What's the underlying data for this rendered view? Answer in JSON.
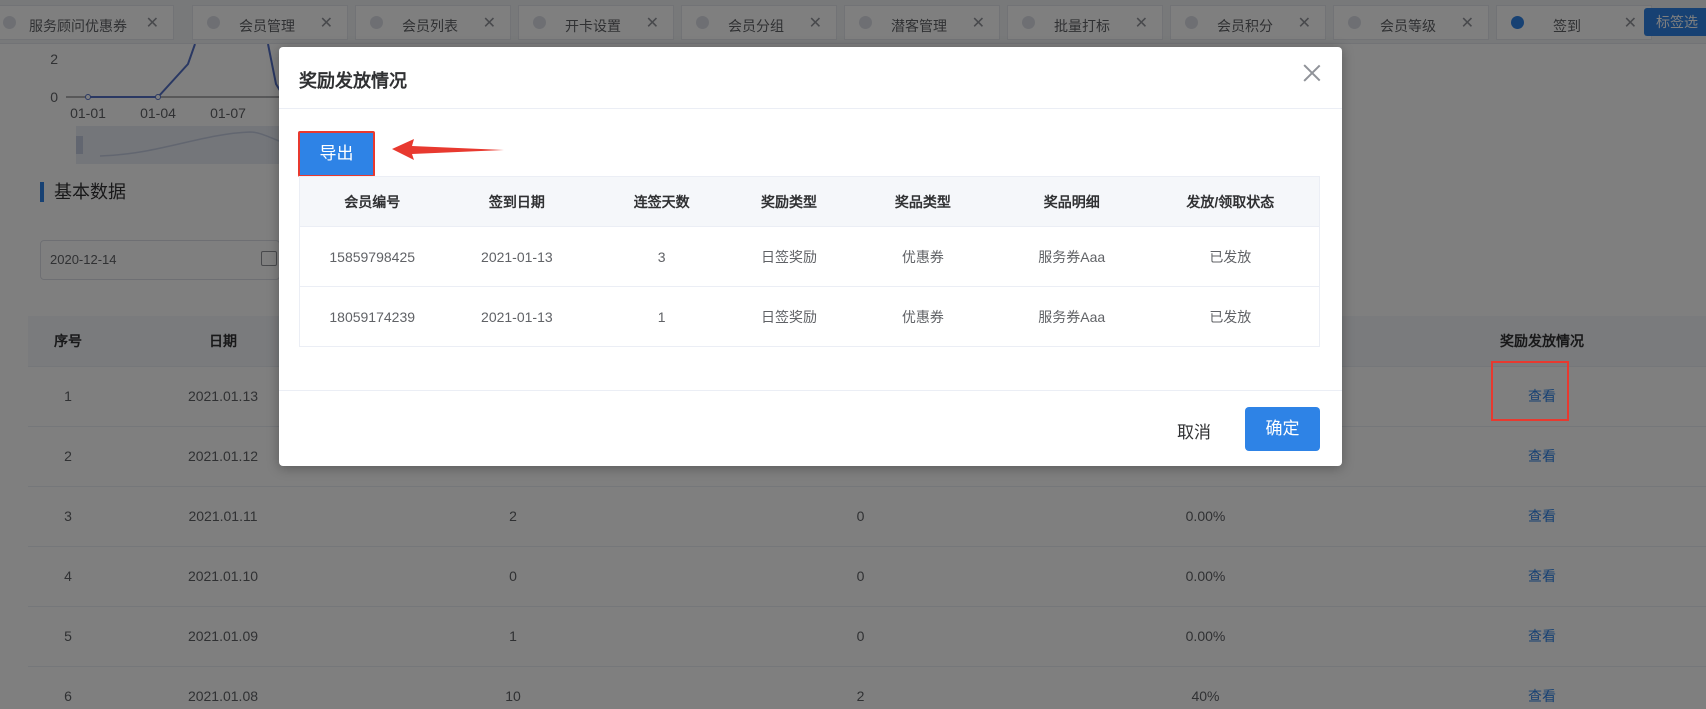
{
  "tabs": [
    {
      "label": "服务顾问优惠券",
      "active": false
    },
    {
      "label": "会员管理",
      "active": false
    },
    {
      "label": "会员列表",
      "active": false
    },
    {
      "label": "开卡设置",
      "active": false
    },
    {
      "label": "会员分组",
      "active": false
    },
    {
      "label": "潜客管理",
      "active": false
    },
    {
      "label": "批量打标",
      "active": false
    },
    {
      "label": "会员积分",
      "active": false
    },
    {
      "label": "会员等级",
      "active": false
    },
    {
      "label": "签到",
      "active": true
    }
  ],
  "tab_action_label": "标签选",
  "chart": {
    "y_ticks": [
      "2",
      "0"
    ],
    "x_ticks": [
      "01-01",
      "01-04",
      "01-07"
    ]
  },
  "section_title": "基本数据",
  "date_value": "2020-12-14",
  "bg_table": {
    "headers": [
      "序号",
      "日期",
      "",
      "",
      "",
      "奖励发放情况"
    ],
    "rows": [
      [
        "1",
        "2021.01.13",
        "",
        "",
        "",
        "查看"
      ],
      [
        "2",
        "2021.01.12",
        "",
        "",
        "",
        "查看"
      ],
      [
        "3",
        "2021.01.11",
        "2",
        "0",
        "0.00%",
        "查看"
      ],
      [
        "4",
        "2021.01.10",
        "0",
        "0",
        "0.00%",
        "查看"
      ],
      [
        "5",
        "2021.01.09",
        "1",
        "0",
        "0.00%",
        "查看"
      ],
      [
        "6",
        "2021.01.08",
        "10",
        "2",
        "40%",
        "查看"
      ]
    ]
  },
  "dialog": {
    "title": "奖励发放情况",
    "export_label": "导出",
    "headers": [
      "会员编号",
      "签到日期",
      "连签天数",
      "奖励类型",
      "奖品类型",
      "奖品明细",
      "发放/领取状态"
    ],
    "rows": [
      [
        "15859798425",
        "2021-01-13",
        "3",
        "日签奖励",
        "优惠券",
        "服务券Aaa",
        "已发放"
      ],
      [
        "18059174239",
        "2021-01-13",
        "1",
        "日签奖励",
        "优惠券",
        "服务券Aaa",
        "已发放"
      ]
    ],
    "cancel_label": "取消",
    "confirm_label": "确定"
  },
  "colors": {
    "primary": "#2e83e6",
    "highlight": "#e8392f"
  }
}
